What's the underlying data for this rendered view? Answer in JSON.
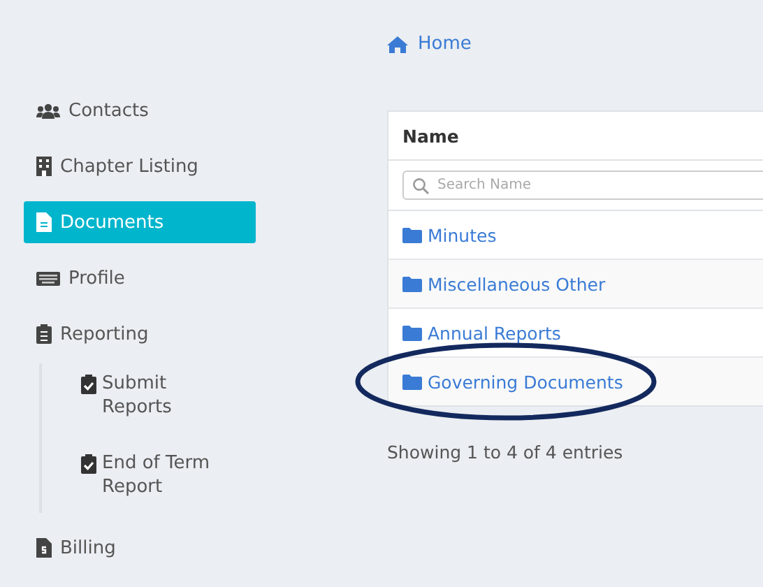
{
  "breadcrumb": {
    "label": "Home"
  },
  "sidebar": {
    "items": [
      {
        "label": "Contacts",
        "selected": false
      },
      {
        "label": "Chapter Listing",
        "selected": false
      },
      {
        "label": "Documents",
        "selected": true
      },
      {
        "label": "Profile",
        "selected": false
      },
      {
        "label": "Reporting",
        "selected": false,
        "children": [
          {
            "label": "Submit Reports",
            "selected": false
          },
          {
            "label": "End of Term Report",
            "selected": false
          }
        ]
      },
      {
        "label": "Billing",
        "selected": false
      }
    ]
  },
  "table": {
    "columns": [
      "Name"
    ],
    "search": {
      "placeholder": "Search Name"
    },
    "rows": [
      {
        "name": "Minutes",
        "highlighted": false
      },
      {
        "name": "Miscellaneous Other",
        "highlighted": false
      },
      {
        "name": "Annual Reports",
        "highlighted": false
      },
      {
        "name": "Governing Documents",
        "highlighted": true
      }
    ],
    "info": "Showing 1 to 4 of 4 entries"
  }
}
